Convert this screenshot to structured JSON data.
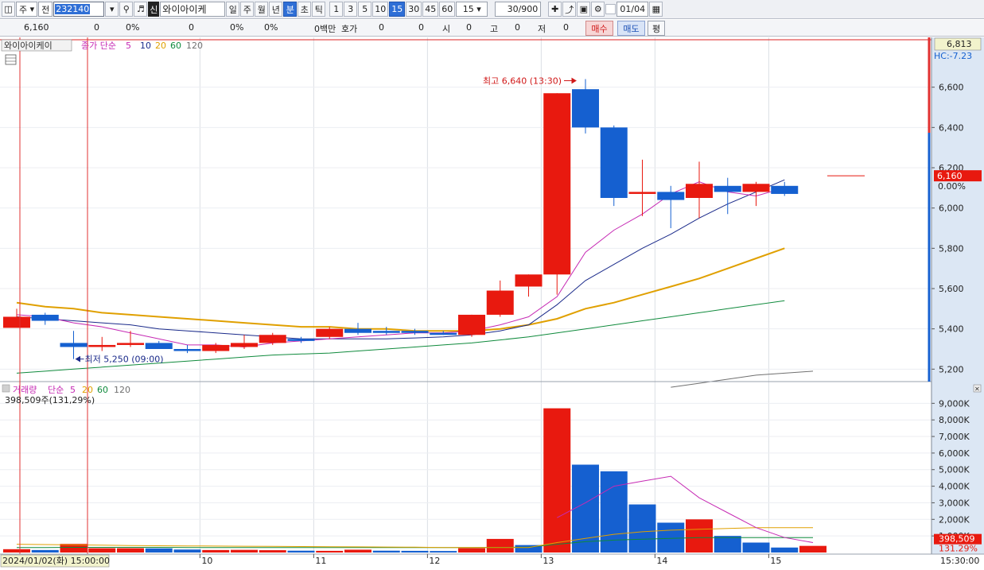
{
  "toolbar": {
    "period_select": "주",
    "prev_select": "전",
    "code": "232140",
    "shin": "신",
    "name": "와이아이케",
    "periods": [
      "일",
      "주",
      "월",
      "년",
      "분",
      "초",
      "틱"
    ],
    "minutes": [
      "1",
      "3",
      "5",
      "10",
      "15",
      "30",
      "45",
      "60"
    ],
    "minute_value": "15",
    "count": "30/900",
    "date": "01/04"
  },
  "quote": {
    "price": "6,160",
    "change": "0",
    "change_pct": "0%",
    "volume": "0",
    "volume_pct": "0%",
    "extra_pct": "0%",
    "amount_label": "0백만",
    "hoga_label": "호가",
    "hoga_val1": "0",
    "hoga_val2": "0",
    "open_label": "시",
    "open_val": "0",
    "high_label": "고",
    "high_val": "0",
    "low_label": "저",
    "low_val": "0",
    "buy_button": "매수",
    "sell_button": "매도",
    "flat_button": "평"
  },
  "colors": {
    "up": "#e8190f",
    "down": "#1560d0",
    "ma5": "#c62ab4",
    "ma10": "#1a2a8a",
    "ma20": "#e0a000",
    "ma60": "#0f8a3c",
    "ma120": "#707070"
  },
  "chart_data": [
    {
      "type": "candlestick",
      "legend": {
        "name": "와이아이케이",
        "ma_label": "종가 단순",
        "periods": [
          "5",
          "10",
          "20",
          "60",
          "120"
        ]
      },
      "top_value": "6,813",
      "top_sub_label": "HC:-7.23",
      "ylim": [
        5150,
        6800
      ],
      "y_ticks": [
        "6,600",
        "6,400",
        "6,200",
        "6,000",
        "5,800",
        "5,600",
        "5,400",
        "5,200"
      ],
      "last_price_label": "6,160",
      "last_pct_label": "0.00%",
      "max_annotation": "최고 6,640 (13:30)",
      "min_annotation": "최저 5,250 (09:00)",
      "x_date_labels": [
        "10",
        "11",
        "12",
        "13",
        "14",
        "15"
      ],
      "x_time_label": "15:30:00",
      "cursor_label": "2024/01/02(화) 15:00:00",
      "candles": [
        {
          "o": 5405,
          "h": 5500,
          "l": 5410,
          "c": 5460
        },
        {
          "o": 5470,
          "h": 5480,
          "l": 5420,
          "c": 5440
        },
        {
          "o": 5330,
          "h": 5390,
          "l": 5250,
          "c": 5310
        },
        {
          "o": 5310,
          "h": 5360,
          "l": 5290,
          "c": 5320
        },
        {
          "o": 5320,
          "h": 5390,
          "l": 5310,
          "c": 5330
        },
        {
          "o": 5330,
          "h": 5340,
          "l": 5300,
          "c": 5300
        },
        {
          "o": 5300,
          "h": 5320,
          "l": 5280,
          "c": 5290
        },
        {
          "o": 5290,
          "h": 5330,
          "l": 5280,
          "c": 5320
        },
        {
          "o": 5310,
          "h": 5370,
          "l": 5300,
          "c": 5330
        },
        {
          "o": 5330,
          "h": 5380,
          "l": 5320,
          "c": 5370
        },
        {
          "o": 5350,
          "h": 5360,
          "l": 5330,
          "c": 5340
        },
        {
          "o": 5360,
          "h": 5410,
          "l": 5350,
          "c": 5400
        },
        {
          "o": 5400,
          "h": 5430,
          "l": 5370,
          "c": 5380
        },
        {
          "o": 5390,
          "h": 5410,
          "l": 5370,
          "c": 5380
        },
        {
          "o": 5390,
          "h": 5400,
          "l": 5370,
          "c": 5380
        },
        {
          "o": 5380,
          "h": 5390,
          "l": 5370,
          "c": 5370
        },
        {
          "o": 5370,
          "h": 5470,
          "l": 5360,
          "c": 5470
        },
        {
          "o": 5470,
          "h": 5640,
          "l": 5460,
          "c": 5590
        },
        {
          "o": 5610,
          "h": 5670,
          "l": 5560,
          "c": 5670
        },
        {
          "o": 5670,
          "h": 6570,
          "l": 5570,
          "c": 6570
        },
        {
          "o": 6590,
          "h": 6640,
          "l": 6370,
          "c": 6400
        },
        {
          "o": 6400,
          "h": 6410,
          "l": 6010,
          "c": 6050
        },
        {
          "o": 6070,
          "h": 6240,
          "l": 5960,
          "c": 6080
        },
        {
          "o": 6080,
          "h": 6110,
          "l": 5900,
          "c": 6040
        },
        {
          "o": 6050,
          "h": 6230,
          "l": 5950,
          "c": 6120
        },
        {
          "o": 6110,
          "h": 6150,
          "l": 5970,
          "c": 6080
        },
        {
          "o": 6080,
          "h": 6130,
          "l": 6010,
          "c": 6120
        },
        {
          "o": 6110,
          "h": 6130,
          "l": 6060,
          "c": 6070
        }
      ],
      "ma5_values": [
        5470,
        5460,
        5430,
        5410,
        5380,
        5350,
        5320,
        5320,
        5310,
        5330,
        5340,
        5350,
        5360,
        5370,
        5380,
        5380,
        5390,
        5420,
        5460,
        5560,
        5780,
        5890,
        5970,
        6070,
        6130,
        6080,
        6060,
        6100
      ],
      "ma10_values": [
        5460,
        5450,
        5440,
        5430,
        5420,
        5400,
        5390,
        5380,
        5370,
        5360,
        5350,
        5350,
        5350,
        5350,
        5355,
        5360,
        5370,
        5390,
        5420,
        5520,
        5640,
        5720,
        5800,
        5870,
        5950,
        6020,
        6080,
        6140
      ],
      "ma20_values": [
        5530,
        5510,
        5500,
        5480,
        5470,
        5460,
        5450,
        5440,
        5430,
        5420,
        5410,
        5410,
        5400,
        5400,
        5390,
        5390,
        5390,
        5400,
        5420,
        5450,
        5500,
        5530,
        5570,
        5610,
        5650,
        5700,
        5750,
        5800
      ],
      "ma60_values": [
        5180,
        5190,
        5200,
        5210,
        5220,
        5230,
        5240,
        5250,
        5260,
        5270,
        5275,
        5280,
        5290,
        5300,
        5310,
        5320,
        5330,
        5345,
        5360,
        5380,
        5400,
        5420,
        5440,
        5460,
        5480,
        5500,
        5520,
        5540
      ],
      "ma120_segment": {
        "start_index": 23,
        "values": [
          5110,
          5130,
          5150,
          5170,
          5180,
          5190
        ]
      }
    },
    {
      "type": "bar",
      "legend": {
        "name": "거래량",
        "ma_label": "단순",
        "periods": [
          "5",
          "20",
          "60",
          "120"
        ]
      },
      "value_label": "398,509주(131,29%)",
      "last_volume_label": "398,509",
      "last_pct_label": "131.29%",
      "ylim": [
        0,
        9400000
      ],
      "y_ticks": [
        "9,000K",
        "8,000K",
        "7,000K",
        "6,000K",
        "5,000K",
        "4,000K",
        "3,000K",
        "2,000K",
        "1,000K"
      ],
      "volumes": [
        200000,
        150000,
        520000,
        260000,
        260000,
        250000,
        180000,
        150000,
        160000,
        140000,
        110000,
        100000,
        170000,
        110000,
        100000,
        90000,
        260000,
        820000,
        450000,
        8700000,
        5300000,
        4900000,
        2900000,
        1800000,
        2000000,
        1000000,
        600000,
        300000,
        400000
      ],
      "volume_directions": [
        "up",
        "down",
        "up",
        "up",
        "up",
        "down",
        "down",
        "up",
        "up",
        "up",
        "down",
        "up",
        "up",
        "down",
        "down",
        "down",
        "up",
        "up",
        "down",
        "up",
        "down",
        "down",
        "down",
        "down",
        "up",
        "down",
        "down",
        "down",
        "up"
      ],
      "ma5_values": [
        null,
        null,
        null,
        null,
        null,
        null,
        null,
        null,
        null,
        null,
        null,
        null,
        null,
        null,
        null,
        null,
        null,
        null,
        null,
        2100000,
        3000000,
        4000000,
        4300000,
        4600000,
        3300000,
        2400000,
        1500000,
        900000,
        600000
      ],
      "ma20_values": [
        500000,
        480000,
        460000,
        440000,
        420000,
        410000,
        400000,
        390000,
        380000,
        370000,
        360000,
        350000,
        340000,
        330000,
        320000,
        300000,
        300000,
        300000,
        300000,
        600000,
        850000,
        1100000,
        1250000,
        1350000,
        1400000,
        1450000,
        1500000,
        1500000,
        1500000
      ],
      "ma60_values": [
        300000,
        300000,
        310000,
        310000,
        310000,
        310000,
        300000,
        300000,
        300000,
        300000,
        300000,
        300000,
        300000,
        300000,
        300000,
        300000,
        300000,
        310000,
        320000,
        500000,
        650000,
        750000,
        800000,
        850000,
        900000,
        900000,
        900000,
        900000,
        900000
      ]
    }
  ]
}
